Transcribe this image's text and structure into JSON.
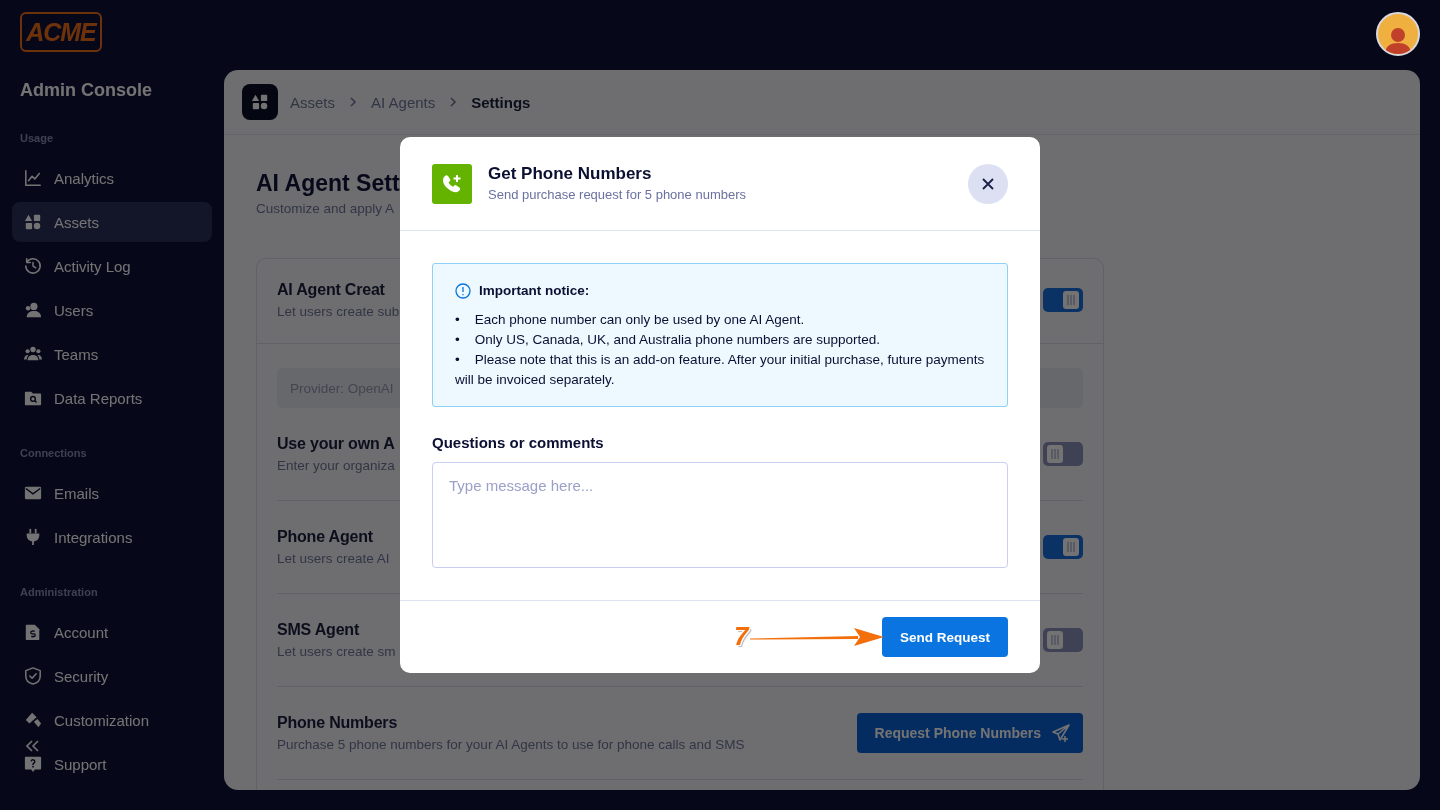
{
  "sidebar": {
    "logo": "ACME",
    "title": "Admin Console",
    "sections": [
      {
        "label": "Usage",
        "items": [
          {
            "label": "Analytics",
            "selected": false
          },
          {
            "label": "Assets",
            "selected": true
          },
          {
            "label": "Activity Log",
            "selected": false
          },
          {
            "label": "Users",
            "selected": false
          },
          {
            "label": "Teams",
            "selected": false
          },
          {
            "label": "Data Reports",
            "selected": false
          }
        ]
      },
      {
        "label": "Connections",
        "items": [
          {
            "label": "Emails",
            "selected": false
          },
          {
            "label": "Integrations",
            "selected": false
          }
        ]
      },
      {
        "label": "Administration",
        "items": [
          {
            "label": "Account",
            "selected": false
          },
          {
            "label": "Security",
            "selected": false
          },
          {
            "label": "Customization",
            "selected": false
          },
          {
            "label": "Support",
            "selected": false
          }
        ]
      }
    ]
  },
  "breadcrumb": [
    {
      "label": "Assets",
      "current": false
    },
    {
      "label": "AI Agents",
      "current": false
    },
    {
      "label": "Settings",
      "current": true
    }
  ],
  "page": {
    "title": "AI Agent Sett",
    "subtitle": "Customize and apply A"
  },
  "settings": [
    {
      "kind": "toggle",
      "title": "AI Agent Creat",
      "description": "Let users create sub",
      "on": true
    },
    {
      "kind": "field",
      "value": "Provider: OpenAI"
    },
    {
      "kind": "toggle",
      "title": "Use your own A",
      "description": "Enter your organiza",
      "on": false
    },
    {
      "kind": "toggle",
      "title": "Phone Agent",
      "description": "Let users create AI",
      "on": true
    },
    {
      "kind": "toggle",
      "title": "SMS Agent",
      "description": "Let users create sm",
      "on": false
    },
    {
      "kind": "button",
      "title": "Phone Numbers",
      "description": "Purchase 5 phone numbers for your AI Agents to use for phone calls and SMS",
      "button": "Request Phone Numbers"
    }
  ],
  "modal": {
    "title": "Get Phone Numbers",
    "subtitle": "Send purchase request for 5 phone numbers",
    "notice": {
      "heading": "Important notice:",
      "items": [
        "•    Each phone number can only be used by one AI Agent.",
        "•    Only US, Canada, UK, and Australia phone numbers are supported.",
        "•    Please note that this is an add-on feature. After your initial purchase, future payments will be invoiced separately."
      ]
    },
    "comments": {
      "label": "Questions or comments",
      "placeholder": "Type message here..."
    },
    "submit": "Send Request"
  },
  "annotation": {
    "label": "7"
  }
}
